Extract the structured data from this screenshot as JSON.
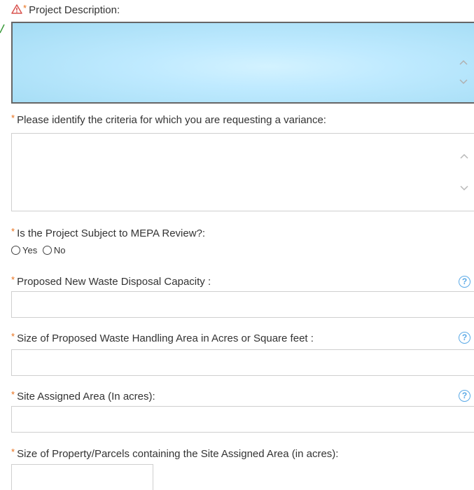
{
  "form": {
    "project_description_label": "Project Description:",
    "criteria_label": "Please identify the criteria for which you are requesting a variance:",
    "mepa_label": "Is the Project Subject to MEPA Review?:",
    "mepa_options": [
      "Yes",
      "No"
    ],
    "disposal_capacity_label": "Proposed New Waste Disposal Capacity :",
    "handling_area_label": "Size of Proposed Waste Handling Area in Acres or Square feet :",
    "site_assigned_label": "Site Assigned Area (In acres):",
    "property_size_label": "Size of Property/Parcels containing the Site Assigned Area (in acres):",
    "required_marker": "*",
    "help_glyph": "?"
  },
  "icons": {
    "warning": "warning-icon",
    "help": "help-icon",
    "scroll_up": "chevron-up-icon",
    "scroll_down": "chevron-down-icon"
  },
  "colors": {
    "required": "#e8701a",
    "help": "#5aa9e6",
    "active_field": "#bfeaff",
    "warning": "#d9534f"
  }
}
